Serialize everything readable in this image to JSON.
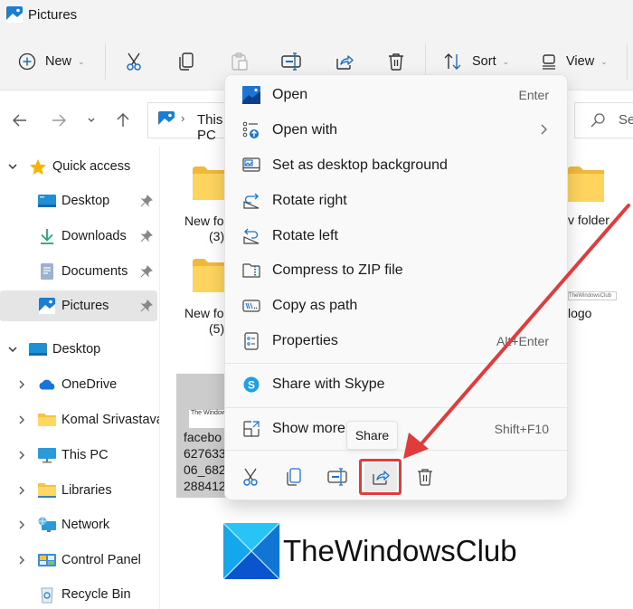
{
  "window": {
    "title": "Pictures"
  },
  "toolbar": {
    "new_label": "New",
    "sort_label": "Sort",
    "view_label": "View",
    "icons": [
      "cut-icon",
      "copy-icon",
      "paste-icon",
      "rename-icon",
      "share-icon",
      "delete-icon"
    ]
  },
  "navigation": {
    "breadcrumb": "This PC",
    "search_placeholder": "Search"
  },
  "sidebar": {
    "quick_access_label": "Quick access",
    "quick_access_items": [
      {
        "label": "Desktop",
        "icon": "desktop-icon",
        "pinned": true
      },
      {
        "label": "Downloads",
        "icon": "downloads-icon",
        "pinned": true
      },
      {
        "label": "Documents",
        "icon": "documents-icon",
        "pinned": true
      },
      {
        "label": "Pictures",
        "icon": "pictures-icon",
        "pinned": true,
        "selected": true
      }
    ],
    "desktop_label": "Desktop",
    "desktop_items": [
      {
        "label": "OneDrive",
        "icon": "onedrive-icon"
      },
      {
        "label": "Komal Srivastava",
        "icon": "folder-icon"
      },
      {
        "label": "This PC",
        "icon": "this-pc-icon"
      },
      {
        "label": "Libraries",
        "icon": "libraries-icon"
      },
      {
        "label": "Network",
        "icon": "network-icon"
      },
      {
        "label": "Control Panel",
        "icon": "control-panel-icon"
      },
      {
        "label": "Recycle Bin",
        "icon": "recycle-bin-icon"
      }
    ]
  },
  "content": {
    "files": [
      {
        "label_line1": "New fo",
        "label_line2": "(3)"
      },
      {
        "label_line1": "New fo",
        "label_line2": "(5)"
      },
      {
        "label_line1": "v folder",
        "label_line2": ""
      },
      {
        "label_line1": "logo",
        "label_line2": ""
      }
    ],
    "selected_file": {
      "thumb_text": "The Windows",
      "name_lines": [
        "facebo",
        "627633",
        "06_682",
        "288412"
      ]
    },
    "logo_thumb_text": "TheWindowsClub"
  },
  "context_menu": {
    "items": [
      {
        "label": "Open",
        "shortcut": "Enter",
        "icon": "photos-icon"
      },
      {
        "label": "Open with",
        "has_submenu": true,
        "icon": "open-with-icon"
      },
      {
        "label": "Set as desktop background",
        "icon": "desktop-background-icon"
      },
      {
        "label": "Rotate right",
        "icon": "rotate-right-icon"
      },
      {
        "label": "Rotate left",
        "icon": "rotate-left-icon"
      },
      {
        "label": "Compress to ZIP file",
        "icon": "zip-icon"
      },
      {
        "label": "Copy as path",
        "icon": "copy-path-icon"
      },
      {
        "label": "Properties",
        "shortcut": "Alt+Enter",
        "icon": "properties-icon"
      },
      {
        "label": "Share with Skype",
        "icon": "skype-icon"
      },
      {
        "label": "Show more options",
        "shortcut": "Shift+F10",
        "icon": "show-more-icon"
      }
    ],
    "bottom_actions": [
      "cut",
      "copy",
      "rename",
      "share",
      "delete"
    ],
    "tooltip": "Share",
    "highlighted_action": "share"
  },
  "annotation": {
    "arrow_color": "#e03c3c",
    "box_color": "#e03c3c"
  },
  "watermark": {
    "text": "TheWindowsClub"
  }
}
